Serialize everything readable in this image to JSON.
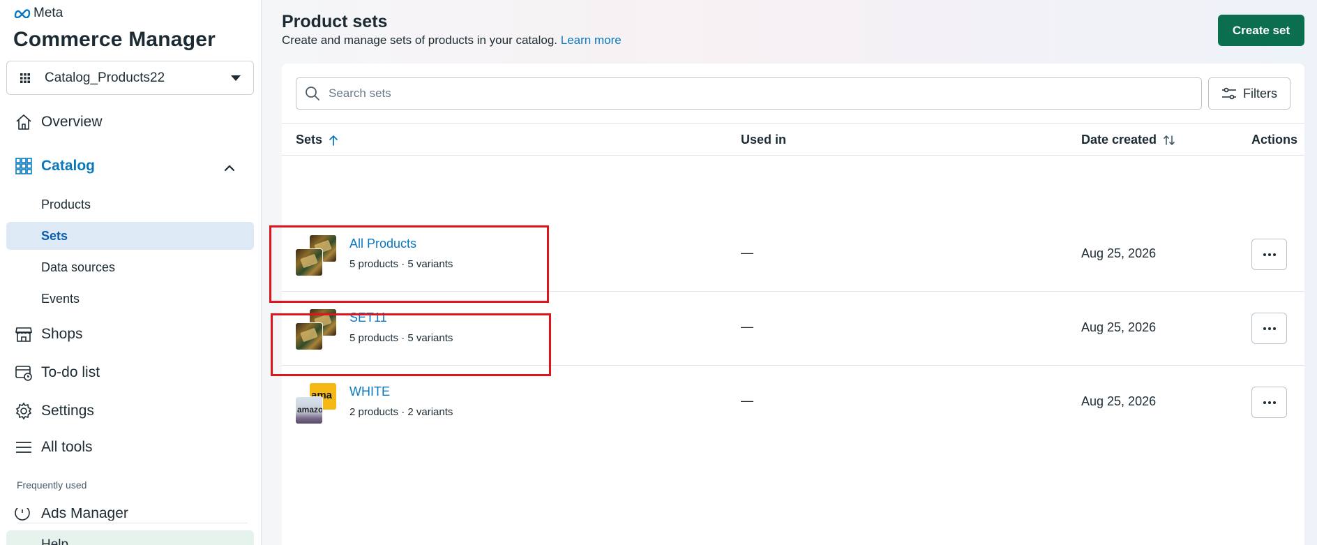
{
  "sidebar": {
    "brand": "Meta",
    "app_title": "Commerce Manager",
    "catalog_selector": {
      "value": "Catalog_Products22",
      "icon": "grid-dots-icon"
    },
    "nav": {
      "overview": "Overview",
      "catalog": "Catalog",
      "catalog_sub": {
        "products": "Products",
        "sets": "Sets",
        "data_sources": "Data sources",
        "events": "Events"
      },
      "shops": "Shops",
      "todo": "To-do list",
      "settings": "Settings",
      "all_tools": "All tools"
    },
    "frequently_used_label": "Frequently used",
    "frequently_used_item": "Ads Manager",
    "help": "Help",
    "selected_item": "Sets"
  },
  "header": {
    "title": "Product sets",
    "subtitle": "Create and manage sets of products in your catalog.",
    "learn_more": "Learn more",
    "create_button": "Create set"
  },
  "toolbar": {
    "search_placeholder": "Search sets",
    "filters_label": "Filters"
  },
  "table": {
    "columns": {
      "sets": "Sets",
      "used_in": "Used in",
      "date_created": "Date created",
      "actions": "Actions"
    },
    "rows": [
      {
        "name": "All Products",
        "meta": "5 products · 5 variants",
        "used_in": "—",
        "date": "Aug 25, 2026"
      },
      {
        "name": "SET11",
        "meta": "5 products · 5 variants",
        "used_in": "—",
        "date": "Aug 25, 2026"
      },
      {
        "name": "WHITE",
        "meta": "2 products · 2 variants",
        "used_in": "—",
        "date": "Aug 25, 2026"
      }
    ]
  },
  "thumb_text": {
    "amazon_partial_top": "ama",
    "amazon_partial_bottom": "amazo"
  },
  "colors": {
    "accent_link": "#0a78be",
    "primary_button": "#0a6e4f",
    "selected_nav_bg": "#dde9f5",
    "highlight_box": "#e0141c"
  }
}
